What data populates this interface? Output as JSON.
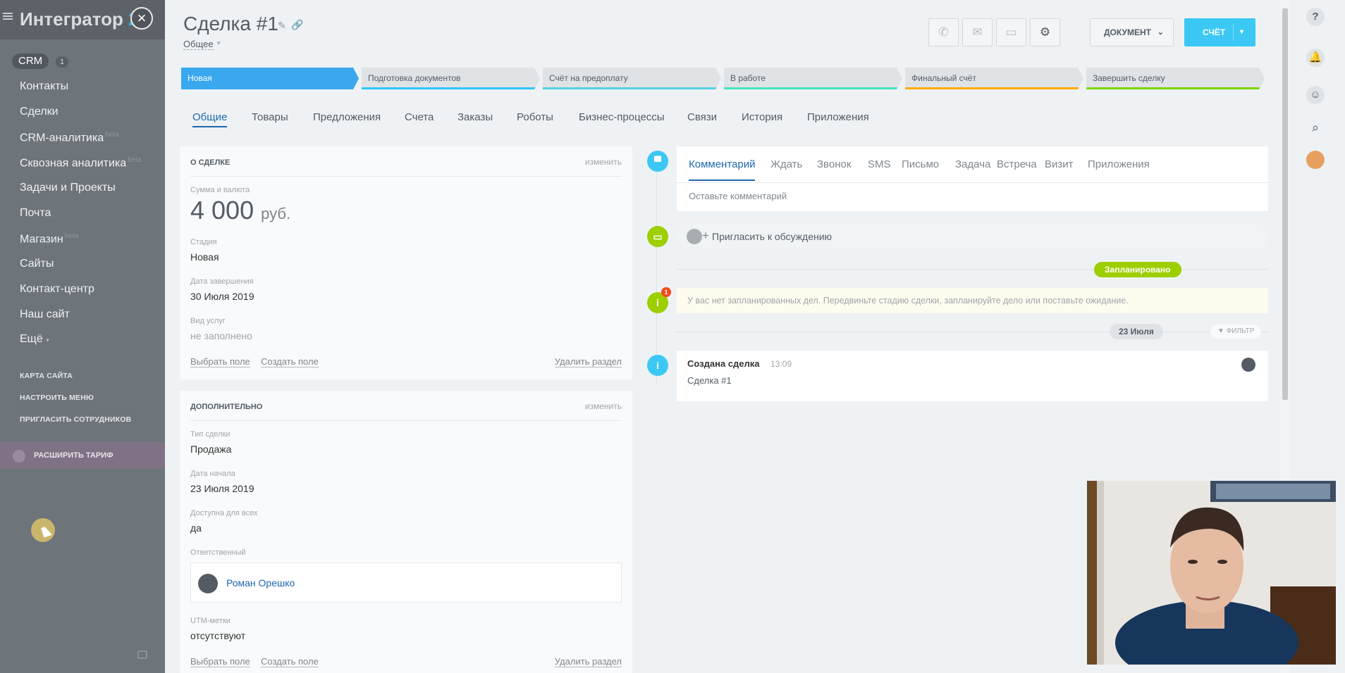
{
  "sidebar": {
    "logo_text": "Интегратор",
    "logo_suffix": "24",
    "crm_label": "CRM",
    "crm_count": "1",
    "items": [
      {
        "label": "Контакты"
      },
      {
        "label": "Сделки"
      },
      {
        "label": "CRM-аналитика",
        "tag": "beta"
      },
      {
        "label": "Сквозная аналитика",
        "tag": "beta"
      },
      {
        "label": "Задачи и Проекты"
      },
      {
        "label": "Почта"
      },
      {
        "label": "Магазин",
        "tag": "beta"
      },
      {
        "label": "Сайты"
      },
      {
        "label": "Контакт-центр"
      },
      {
        "label": "Наш сайт"
      },
      {
        "label": "Ещё"
      }
    ],
    "links": [
      "КАРТА САЙТА",
      "НАСТРОИТЬ МЕНЮ",
      "ПРИГЛАСИТЬ СОТРУДНИКОВ"
    ],
    "tarif_label": "РАСШИРИТЬ ТАРИФ"
  },
  "header": {
    "title": "Сделка #1",
    "subtitle": "Общее",
    "document_button": "ДОКУМЕНТ",
    "invoice_button": "СЧЁТ"
  },
  "stages": [
    {
      "label": "Новая",
      "color": "#39a8ef",
      "active": true
    },
    {
      "label": "Подготовка документов",
      "color": "#2fc6f6"
    },
    {
      "label": "Счёт на предоплату",
      "color": "#55d0e0"
    },
    {
      "label": "В работе",
      "color": "#47e4c2"
    },
    {
      "label": "Финальный счёт",
      "color": "#ffa900"
    },
    {
      "label": "Завершить сделку",
      "color": "#7bd500"
    }
  ],
  "tabs": [
    "Общие",
    "Товары",
    "Предложения",
    "Счета",
    "Заказы",
    "Роботы",
    "Бизнес-процессы",
    "Связи",
    "История",
    "Приложения"
  ],
  "about": {
    "title": "О СДЕЛКЕ",
    "edit": "изменить",
    "amount_label": "Сумма и валюта",
    "amount_value": "4 000",
    "amount_currency": "руб.",
    "stage_label": "Стадия",
    "stage_value": "Новая",
    "close_date_label": "Дата завершения",
    "close_date_value": "30 Июля 2019",
    "service_label": "Вид услуг",
    "service_value": "не заполнено",
    "select_field": "Выбрать поле",
    "create_field": "Создать поле",
    "delete_section": "Удалить раздел"
  },
  "extra": {
    "title": "ДОПОЛНИТЕЛЬНО",
    "edit": "изменить",
    "type_label": "Тип сделки",
    "type_value": "Продажа",
    "start_label": "Дата начала",
    "start_value": "23 Июля 2019",
    "available_label": "Доступна для всех",
    "available_value": "да",
    "responsible_label": "Ответственный",
    "responsible_value": "Роман Орешко",
    "utm_label": "UTM-метки",
    "utm_value": "отсутствуют",
    "select_field": "Выбрать поле",
    "create_field": "Создать поле",
    "delete_section": "Удалить раздел"
  },
  "timeline": {
    "editor_tabs": [
      "Комментарий",
      "Ждать",
      "Звонок",
      "SMS",
      "Письмо",
      "Задача",
      "Встреча",
      "Визит",
      "Приложения"
    ],
    "comment_placeholder": "Оставьте комментарий",
    "invite_label": "Пригласить к обсуждению",
    "planned_label": "Запланировано",
    "empty_note": "У вас нет запланированных дел. Передвиньте стадию сделки, запланируйте дело или поставьте ожидание.",
    "notice_count": "1",
    "date_label": "23 Июля",
    "filter_label": "ФИЛЬТР",
    "event_title": "Создана сделка",
    "event_time": "13:09",
    "event_body": "Сделка #1"
  },
  "colors": {
    "accent": "#2067b0",
    "invoice_button": "#3bc8f5",
    "planned": "#9dcf00"
  }
}
